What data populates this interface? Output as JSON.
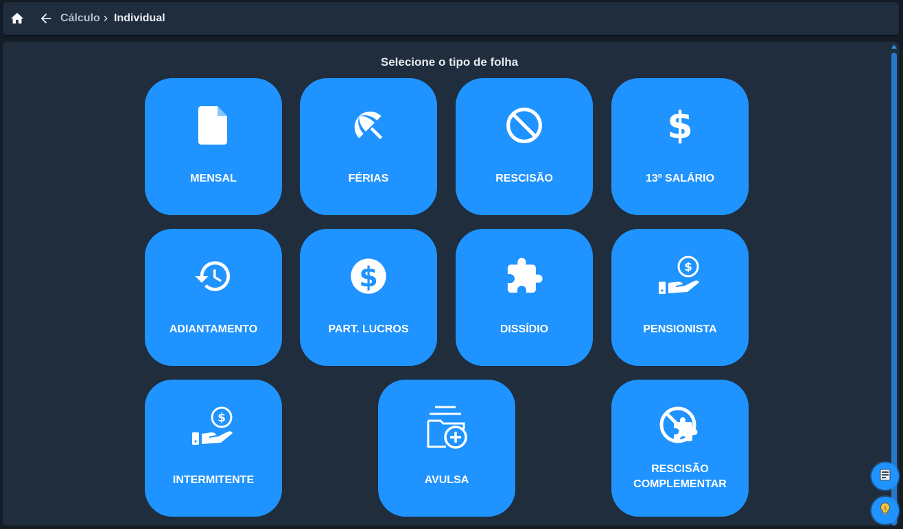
{
  "breadcrumb": {
    "items": [
      {
        "label": "Cálculo"
      },
      {
        "label": "Individual"
      }
    ]
  },
  "page_title": "Selecione o tipo de folha",
  "tiles": [
    {
      "label": "MENSAL",
      "icon": "file-icon"
    },
    {
      "label": "FÉRIAS",
      "icon": "beach-umbrella-icon"
    },
    {
      "label": "RESCISÃO",
      "icon": "block-icon"
    },
    {
      "label": "13º SALÁRIO",
      "icon": "dollar-sign-icon"
    },
    {
      "label": "ADIANTAMENTO",
      "icon": "history-icon"
    },
    {
      "label": "PART. LUCROS",
      "icon": "dollar-circle-icon"
    },
    {
      "label": "DISSÍDIO",
      "icon": "puzzle-icon"
    },
    {
      "label": "PENSIONISTA",
      "icon": "hand-coin-icon"
    },
    {
      "label": "INTERMITENTE",
      "icon": "hand-coin-icon"
    },
    {
      "label": "AVULSA",
      "icon": "folder-plus-icon"
    },
    {
      "label_line1": "RESCISÃO",
      "label_line2": "COMPLEMENTAR",
      "icon": "block-puzzle-icon"
    }
  ],
  "colors": {
    "background": "#141c26",
    "panel": "#1f2d3d",
    "tile": "#1f93ff",
    "text": "#ffffff"
  }
}
